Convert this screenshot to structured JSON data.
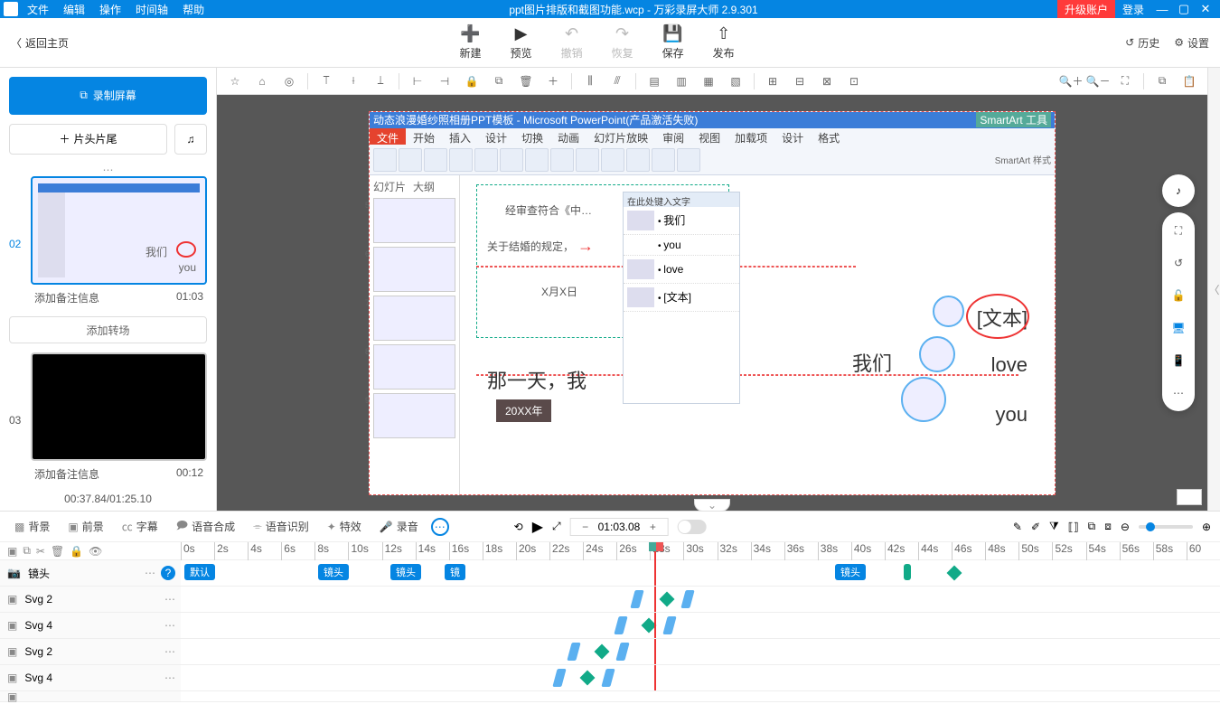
{
  "titlebar": {
    "menus": [
      "文件",
      "编辑",
      "操作",
      "时间轴",
      "帮助"
    ],
    "title": "ppt图片排版和截图功能.wcp - 万彩录屏大师 2.9.301",
    "upgrade": "升级账户",
    "login": "登录"
  },
  "toolbar1": {
    "back": "返回主页",
    "buttons": [
      {
        "label": "新建"
      },
      {
        "label": "预览"
      },
      {
        "label": "撤销"
      },
      {
        "label": "恢复"
      },
      {
        "label": "保存"
      },
      {
        "label": "发布"
      }
    ],
    "history": "历史",
    "settings": "设置"
  },
  "leftpanel": {
    "record": "录制屏幕",
    "headtail": "片头片尾",
    "scene2": {
      "num": "02",
      "note": "添加备注信息",
      "dur": "01:03",
      "trans": "添加转场",
      "thumb_t1": "我们",
      "thumb_t2": "you"
    },
    "scene3": {
      "num": "03",
      "note": "添加备注信息",
      "dur": "00:12"
    },
    "timecode": "00:37.84/01:25.10"
  },
  "ppt": {
    "title": "动态浪漫婚纱照相册PPT模板 - Microsoft PowerPoint(产品激活失败)",
    "smartart": "SmartArt 工具",
    "tabs": [
      "文件",
      "开始",
      "插入",
      "设计",
      "切换",
      "动画",
      "幻灯片放映",
      "审阅",
      "视图",
      "加载项",
      "设计",
      "格式"
    ],
    "sidehead": "在此处键入文字",
    "siderows": [
      "我们",
      "you",
      "love",
      "[文本]"
    ],
    "txt_check": "经审查符合《中…",
    "txt_marry": "关于结婚的规定，",
    "txt_date": "X月X日",
    "txt_day": "那一天，我",
    "txt_year": "20XX年",
    "txt_wo": "我们",
    "txt_love": "love",
    "txt_you": "you",
    "txt_wenben": "[文本]",
    "smartartstyle": "SmartArt 样式",
    "slidesh": "幻灯片",
    "outlineh": "大纲"
  },
  "btooltabs": {
    "bg": "背景",
    "fg": "前景",
    "subtitle": "字幕",
    "tts": "语音合成",
    "asr": "语音识别",
    "fx": "特效",
    "rec": "录音",
    "timecode": "01:03.08"
  },
  "ruler": [
    "0s",
    "2s",
    "4s",
    "6s",
    "8s",
    "10s",
    "12s",
    "14s",
    "16s",
    "18s",
    "20s",
    "22s",
    "24s",
    "26s",
    "28s",
    "30s",
    "32s",
    "34s",
    "36s",
    "38s",
    "40s",
    "42s",
    "44s",
    "46s",
    "48s",
    "50s",
    "52s",
    "54s",
    "56s",
    "58s",
    "60"
  ],
  "tracks": {
    "camera": "镜头",
    "svg2": "Svg 2",
    "svg4": "Svg 4",
    "svg2b": "Svg 2",
    "svg4b": "Svg 4",
    "camlabels": [
      "默认",
      "镜头",
      "镜头",
      "镜",
      "镜头"
    ]
  }
}
